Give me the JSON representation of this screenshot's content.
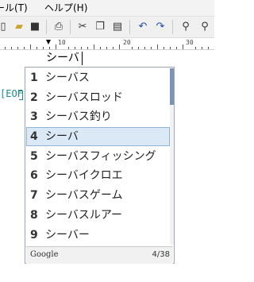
{
  "menubar": {
    "items": [
      "ール(T)",
      "ヘルプ(H)"
    ]
  },
  "toolbar": {
    "icons": [
      "new-document-icon",
      "open-folder-icon",
      "save-icon",
      "print-icon",
      "cut-icon",
      "copy-icon",
      "paste-icon",
      "undo-icon",
      "redo-icon",
      "find-icon",
      "replace-icon"
    ]
  },
  "ruler": {
    "labels": [
      "10",
      "20",
      "30"
    ]
  },
  "editor": {
    "typed_text": "シーバ",
    "eof_text": "EOF"
  },
  "suggestions": {
    "items": [
      {
        "index": "1",
        "text": "シーバス"
      },
      {
        "index": "2",
        "text": "シーバスロッド"
      },
      {
        "index": "3",
        "text": "シーバス釣り"
      },
      {
        "index": "4",
        "text": "シーバ"
      },
      {
        "index": "5",
        "text": "シーバスフィッシング"
      },
      {
        "index": "6",
        "text": "シーバイクロエ"
      },
      {
        "index": "7",
        "text": "シーバスゲーム"
      },
      {
        "index": "8",
        "text": "シーバスルアー"
      },
      {
        "index": "9",
        "text": "シーバー"
      }
    ],
    "selected_index": 4,
    "provider": "Google",
    "position_label": "4/38"
  },
  "colors": {
    "selection_bg": "#dbe8f6",
    "scroll_thumb": "#7d93b3",
    "eof": "#1a8a8a"
  }
}
